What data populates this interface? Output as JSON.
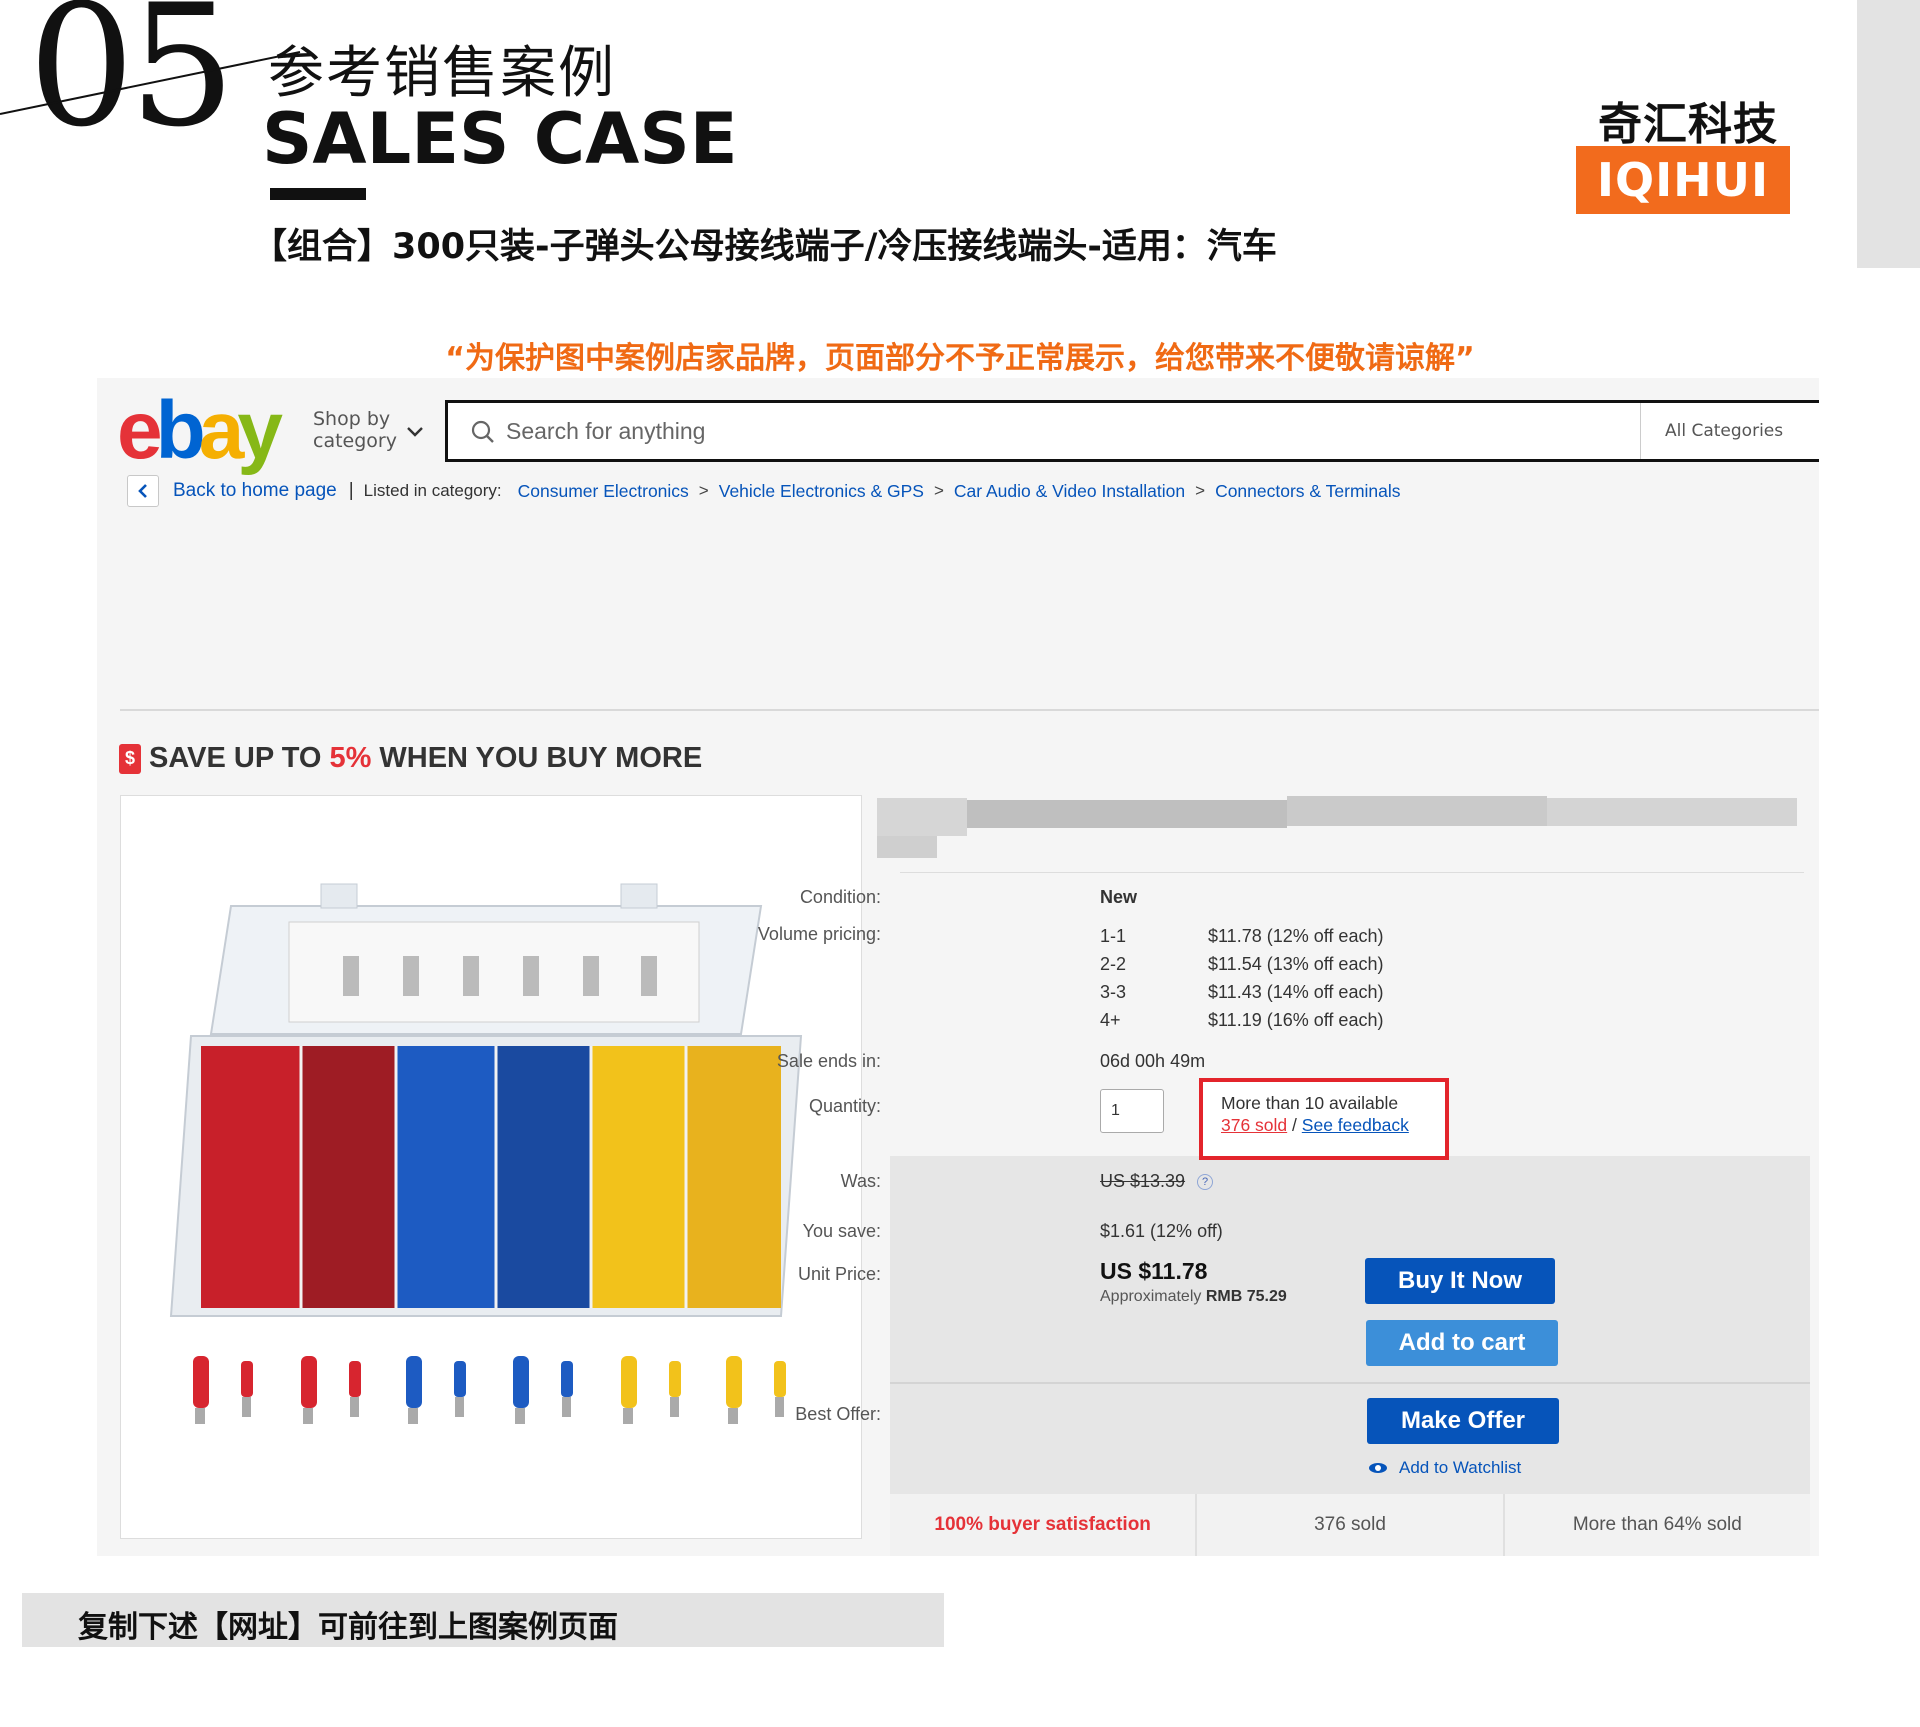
{
  "header": {
    "number": "05",
    "title_cn": "参考销售案例",
    "title_en": "SALES CASE",
    "product_title": "【组合】300只装-子弹头公母接线端子/冷压接线端头-适用：汽车",
    "brand_cn": "奇汇科技",
    "brand_en": "IQIHUI",
    "notice": "“为保护图中案例店家品牌，页面部分不予正常展示，给您带来不便敬请谅解”"
  },
  "ebay": {
    "logo": {
      "e": "e",
      "b": "b",
      "a": "a",
      "y": "y"
    },
    "shop_by_1": "Shop by",
    "shop_by_2": "category",
    "search_placeholder": "Search for anything",
    "all_categories": "All Categories",
    "back_label": "Back to home page",
    "separator": "|",
    "listed_in": "Listed in category:",
    "breadcrumbs": [
      "Consumer Electronics",
      "Vehicle Electronics & GPS",
      "Car Audio & Video Installation",
      "Connectors & Terminals"
    ],
    "gt": ">",
    "save_prefix": "SAVE UP TO",
    "save_pct": "5%",
    "save_suffix": "WHEN YOU BUY MORE",
    "save_icon": "$",
    "condition_label": "Condition:",
    "condition_value": "New",
    "volume_label": "Volume pricing:",
    "volume": [
      {
        "qty": "1-1",
        "price": "$11.78  (12% off each)"
      },
      {
        "qty": "2-2",
        "price": "$11.54  (13% off each)"
      },
      {
        "qty": "3-3",
        "price": "$11.43  (14% off each)"
      },
      {
        "qty": "4+",
        "price": "$11.19  (16% off each)"
      }
    ],
    "sale_ends_label": "Sale ends in:",
    "sale_ends_value": "06d 00h 49m",
    "quantity_label": "Quantity:",
    "quantity_value": "1",
    "available": "More than 10 available",
    "sold_link": "376 sold",
    "slash": "/",
    "feedback_link": "See feedback",
    "was_label": "Was:",
    "was_value": "US $13.39",
    "help_icon": "?",
    "save_label": "You save:",
    "save_value": "$1.61 (12% off)",
    "unit_label": "Unit Price:",
    "unit_value": "US $11.78",
    "approx_prefix": "Approximately",
    "approx_value": "RMB 75.29",
    "buy_now": "Buy It Now",
    "add_to_cart": "Add to cart",
    "best_offer_label": "Best Offer:",
    "make_offer": "Make Offer",
    "watchlist": "Add to Watchlist",
    "stats": [
      "100% buyer satisfaction",
      "376 sold",
      "More than 64% sold"
    ]
  },
  "footer": {
    "copy_text": "复制下述【网址】可前往到上图案例页面"
  },
  "colors": {
    "brand_orange": "#f26b1d",
    "notice_orange": "#f06a14",
    "ebay_blue": "#0654ba",
    "ebay_red": "#e53238",
    "highlight_red": "#e3242b"
  }
}
